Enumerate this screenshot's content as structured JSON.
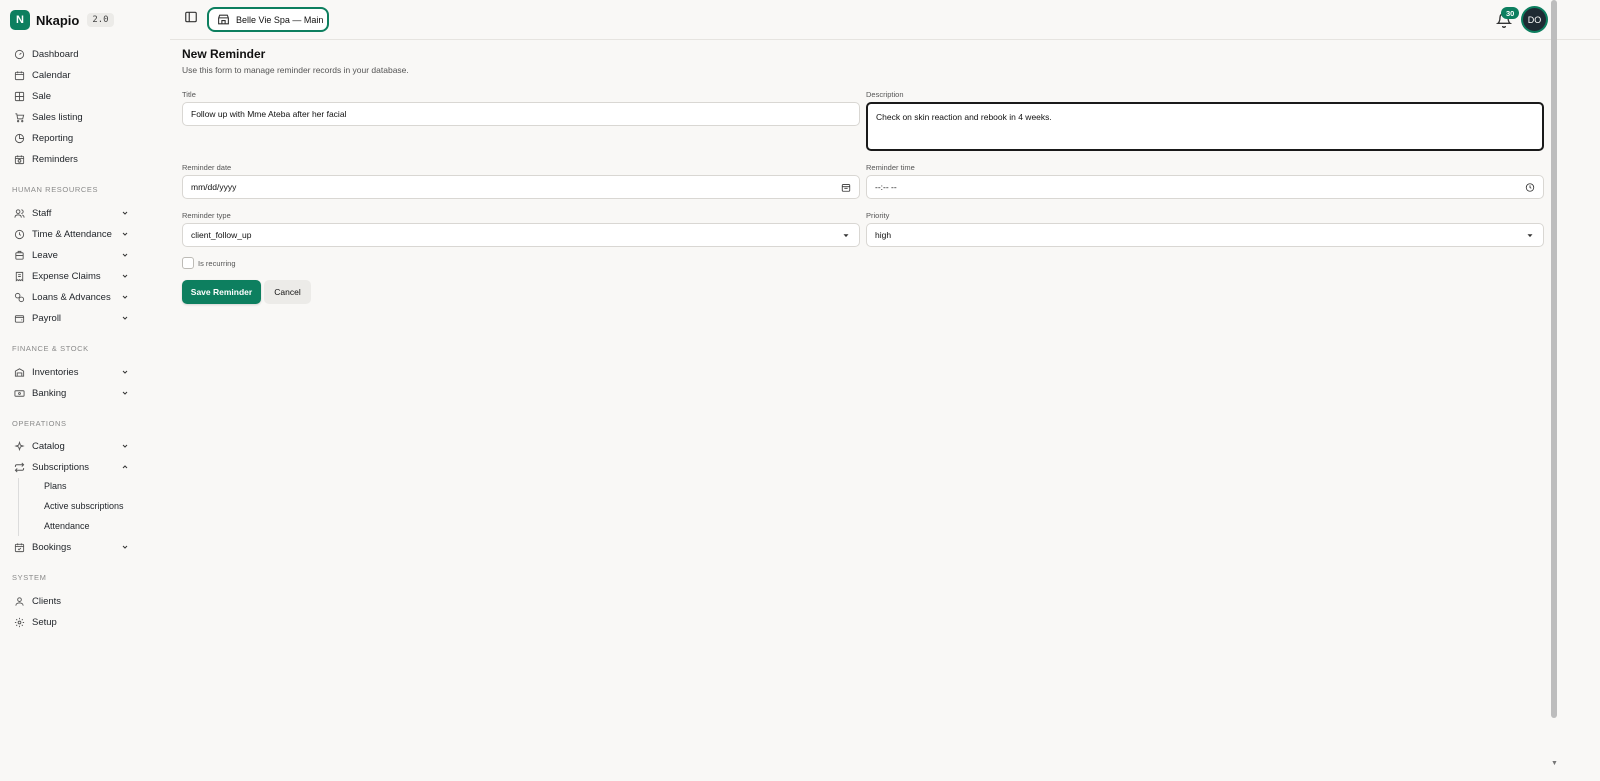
{
  "brand": {
    "name": "Nkapio",
    "version": "2.0",
    "logo_letter": "N",
    "accent": "#0d7f5f"
  },
  "topbar": {
    "store": "Belle Vie Spa — Main",
    "notifications": "30",
    "avatar": "DO"
  },
  "sidebar": {
    "main": [
      {
        "label": "Dashboard",
        "icon": "dashboard-icon"
      },
      {
        "label": "Calendar",
        "icon": "calendar-icon"
      },
      {
        "label": "Sale",
        "icon": "grid-icon"
      },
      {
        "label": "Sales listing",
        "icon": "cart-icon"
      },
      {
        "label": "Reporting",
        "icon": "pie-chart-icon"
      },
      {
        "label": "Reminders",
        "icon": "calendar-clock-icon"
      }
    ],
    "hr_header": "HUMAN RESOURCES",
    "hr": [
      {
        "label": "Staff",
        "icon": "users-icon"
      },
      {
        "label": "Time & Attendance",
        "icon": "clock-icon"
      },
      {
        "label": "Leave",
        "icon": "plane-icon"
      },
      {
        "label": "Expense Claims",
        "icon": "receipt-icon"
      },
      {
        "label": "Loans & Advances",
        "icon": "coins-icon"
      },
      {
        "label": "Payroll",
        "icon": "wallet-icon"
      }
    ],
    "finance_header": "FINANCE & STOCK",
    "finance": [
      {
        "label": "Inventories",
        "icon": "warehouse-icon"
      },
      {
        "label": "Banking",
        "icon": "banknote-icon"
      }
    ],
    "ops_header": "OPERATIONS",
    "ops": [
      {
        "label": "Catalog",
        "icon": "sparkles-icon"
      },
      {
        "label": "Subscriptions",
        "icon": "repeat-icon"
      },
      {
        "label": "Bookings",
        "icon": "calendar-check-icon"
      }
    ],
    "subscriptions_sub": [
      "Plans",
      "Active subscriptions",
      "Attendance"
    ],
    "system_header": "SYSTEM",
    "system": [
      {
        "label": "Clients",
        "icon": "user-icon"
      },
      {
        "label": "Setup",
        "icon": "gear-icon"
      }
    ]
  },
  "form": {
    "title": "New Reminder",
    "subtitle": "Use this form to manage reminder records in your database.",
    "title_label": "Title",
    "title_value": "Follow up with Mme Ateba after her facial",
    "description_label": "Description",
    "description_value": "Check on skin reaction and rebook in 4 weeks.",
    "date_label": "Reminder date",
    "date_value": "mm/dd/yyyy",
    "time_label": "Reminder time",
    "time_value": "--:-- --",
    "type_label": "Reminder type",
    "type_value": "client_follow_up",
    "priority_label": "Priority",
    "priority_value": "high",
    "recurring_label": "Is recurring",
    "save_label": "Save Reminder",
    "cancel_label": "Cancel"
  }
}
